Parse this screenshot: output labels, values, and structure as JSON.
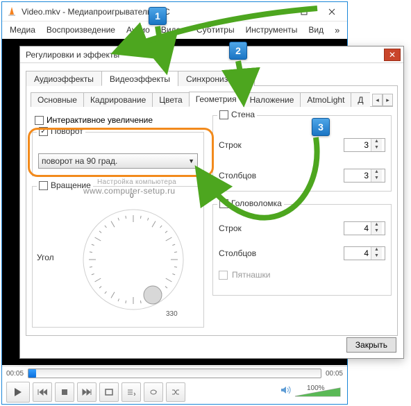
{
  "window": {
    "title": "Video.mkv - Медиапроигрыватель VLC",
    "menu": {
      "media": "Медиа",
      "playback": "Воспроизведение",
      "audio": "Аудио",
      "video": "Видео",
      "subtitle": "Субтитры",
      "tools": "Инструменты",
      "view": "Вид",
      "more": "»"
    },
    "time_left": "00:05",
    "time_right": "00:05",
    "volume_label": "100%"
  },
  "dialog": {
    "title": "Регулировки и эффекты",
    "tabs1": {
      "audio": "Аудиоэффекты",
      "video": "Видеоэффекты",
      "sync": "Синхронизация"
    },
    "tabs2": {
      "basic": "Основные",
      "crop": "Кадрирование",
      "colors": "Цвета",
      "geometry": "Геометрия",
      "overlay": "Наложение",
      "atmolight": "AtmoLight",
      "more": "Д"
    },
    "interactive_zoom": "Интерактивное увеличение",
    "rotate": {
      "legend": "Поворот",
      "value": "поворот на 90 град."
    },
    "rotation": {
      "legend": "Вращение",
      "angle": "Угол",
      "tick0": "0",
      "tick330": "330"
    },
    "wall": {
      "legend": "Стена",
      "rows": "Строк",
      "cols": "Столбцов",
      "rows_val": "3",
      "cols_val": "3"
    },
    "puzzle": {
      "legend": "Головоломка",
      "rows": "Строк",
      "cols": "Столбцов",
      "fifteen": "Пятнашки",
      "rows_val": "4",
      "cols_val": "4"
    },
    "close": "Закрыть"
  },
  "watermark": {
    "line1": "Настройка компьютера",
    "line2": "www.computer-setup.ru"
  },
  "badges": {
    "b1": "1",
    "b2": "2",
    "b3": "3"
  }
}
